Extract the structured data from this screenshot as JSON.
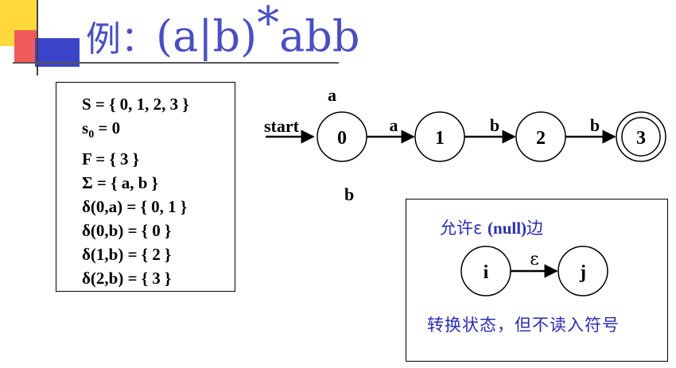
{
  "title": {
    "prefix": "例：",
    "regex": "(a|b)",
    "star": "*",
    "suffix": "abb"
  },
  "definition": {
    "lines": [
      "S = { 0, 1, 2, 3 }",
      "s0 = 0",
      "F = { 3 }",
      "Σ = { a, b }",
      "δ(0,a) = { 0, 1 }",
      "δ(0,b) = { 0 }",
      "δ(1,b) = { 2 }",
      "δ(2,b) = { 3 }"
    ],
    "s0_main": "s",
    "s0_sub": "0",
    "s0_rest": " = 0"
  },
  "nfa": {
    "start_label": "start",
    "states": [
      "0",
      "1",
      "2",
      "3"
    ],
    "accepting_state": "3",
    "self_loop_a": "a",
    "self_loop_b": "b",
    "edge_labels": [
      "a",
      "b",
      "b"
    ]
  },
  "epsilon": {
    "title_prefix": "允许ε ",
    "title_bold": "(null)",
    "title_suffix": "边",
    "state_i": "i",
    "state_j": "j",
    "edge_label": "ε",
    "caption": "转换状态，但不读入符号"
  },
  "colors": {
    "title": "#4a4fc0",
    "note": "#2a2fb0",
    "deco_yellow": "#ffd83a",
    "deco_red": "#f25a5a",
    "deco_blue": "#3b44c8"
  }
}
